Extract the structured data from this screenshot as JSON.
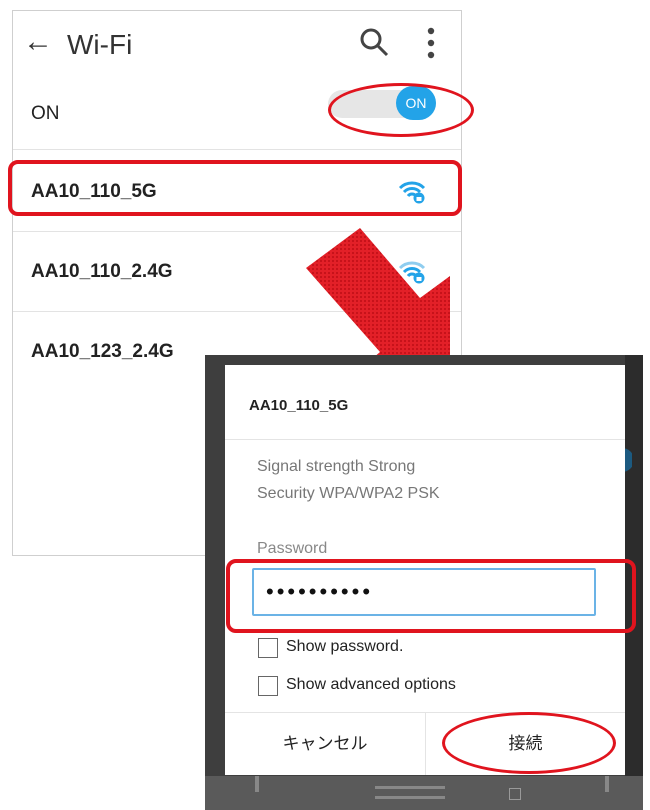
{
  "header": {
    "back_icon": "←",
    "title": "Wi-Fi",
    "search_icon": "search-icon",
    "more_icon": "more-vert-icon"
  },
  "wifi_toggle": {
    "label": "ON",
    "knob_text": "ON"
  },
  "networks": [
    {
      "ssid": "AA10_110_5G"
    },
    {
      "ssid": "AA10_110_2.4G"
    },
    {
      "ssid": "AA10_123_2.4G"
    }
  ],
  "dialog": {
    "title": "AA10_110_5G",
    "signal_strength": "Signal strength  Strong",
    "security": "Security  WPA/WPA2 PSK",
    "password_label": "Password",
    "password_value": "••••••••••",
    "show_password": "Show password.",
    "show_advanced": "Show advanced options",
    "cancel": "キャンセル",
    "connect": "接続"
  },
  "colors": {
    "accent": "#23a3e8",
    "highlight": "#e0141e"
  }
}
